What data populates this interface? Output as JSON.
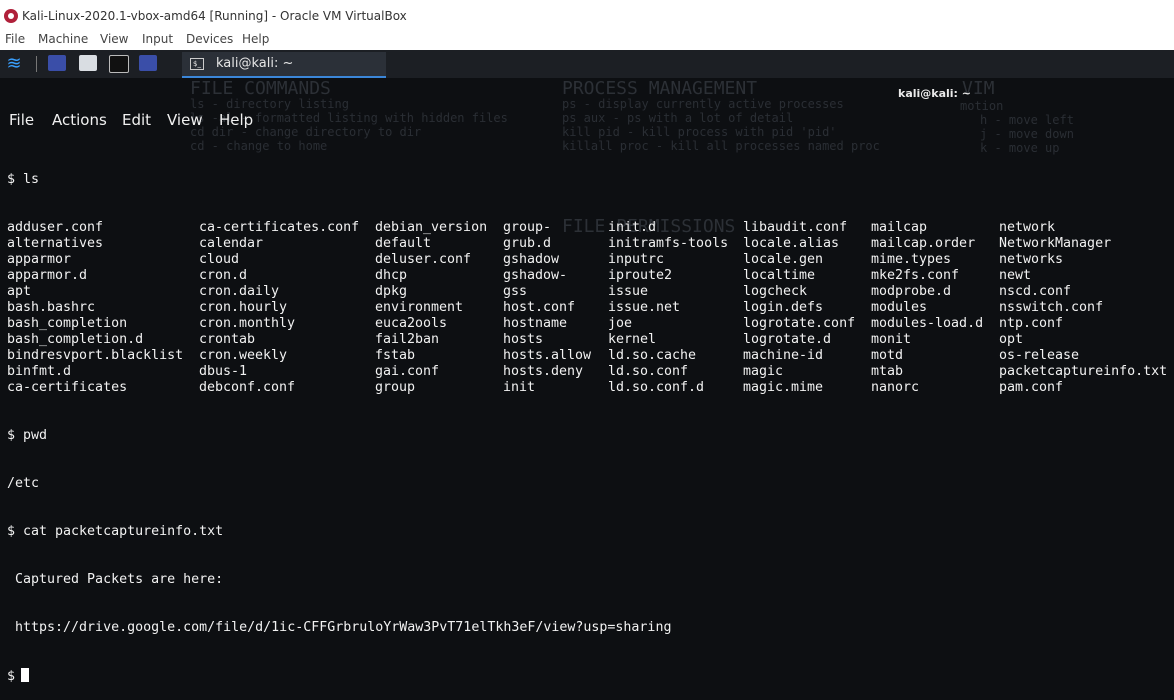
{
  "window": {
    "title": "Kali-Linux-2020.1-vbox-amd64 [Running] - Oracle VM VirtualBox"
  },
  "vbox_menu": [
    "File",
    "Machine",
    "View",
    "Input",
    "Devices",
    "Help"
  ],
  "taskbar": {
    "task_label": "kali@kali: ~"
  },
  "terminal": {
    "title": "kali@kali: ~",
    "menu": [
      "File",
      "Actions",
      "Edit",
      "View",
      "Help"
    ],
    "ls_prompt": "$ ls",
    "ls_rows": [
      [
        "adduser.conf",
        "ca-certificates.conf",
        "debian_version",
        "group-",
        "init.d",
        "libaudit.conf",
        "mailcap",
        "network"
      ],
      [
        "alternatives",
        "calendar",
        "default",
        "grub.d",
        "initramfs-tools",
        "locale.alias",
        "mailcap.order",
        "NetworkManager"
      ],
      [
        "apparmor",
        "cloud",
        "deluser.conf",
        "gshadow",
        "inputrc",
        "locale.gen",
        "mime.types",
        "networks"
      ],
      [
        "apparmor.d",
        "cron.d",
        "dhcp",
        "gshadow-",
        "iproute2",
        "localtime",
        "mke2fs.conf",
        "newt"
      ],
      [
        "apt",
        "cron.daily",
        "dpkg",
        "gss",
        "issue",
        "logcheck",
        "modprobe.d",
        "nscd.conf"
      ],
      [
        "bash.bashrc",
        "cron.hourly",
        "environment",
        "host.conf",
        "issue.net",
        "login.defs",
        "modules",
        "nsswitch.conf"
      ],
      [
        "bash_completion",
        "cron.monthly",
        "euca2ools",
        "hostname",
        "joe",
        "logrotate.conf",
        "modules-load.d",
        "ntp.conf"
      ],
      [
        "bash_completion.d",
        "crontab",
        "fail2ban",
        "hosts",
        "kernel",
        "logrotate.d",
        "monit",
        "opt"
      ],
      [
        "bindresvport.blacklist",
        "cron.weekly",
        "fstab",
        "hosts.allow",
        "ld.so.cache",
        "machine-id",
        "motd",
        "os-release"
      ],
      [
        "binfmt.d",
        "dbus-1",
        "gai.conf",
        "hosts.deny",
        "ld.so.conf",
        "magic",
        "mtab",
        "packetcaptureinfo.txt"
      ],
      [
        "ca-certificates",
        "debconf.conf",
        "group",
        "init",
        "ld.so.conf.d",
        "magic.mime",
        "nanorc",
        "pam.conf"
      ]
    ],
    "pwd_prompt": "$ pwd",
    "pwd_output": "/etc",
    "cat_prompt": "$ cat packetcaptureinfo.txt",
    "cat_line1": " Captured Packets are here:",
    "cat_line2": " https://drive.google.com/file/d/1ic-CFFGrbruloYrWaw3PvT71elTkh3eF/view?usp=sharing",
    "final_prompt": "$"
  },
  "wallpaper": {
    "h1": "FILE COMMANDS",
    "h2": "PROCESS MANAGEMENT",
    "h3": "VIM",
    "h4": "FILE PERMISSIONS",
    "l1": "ls - directory listing",
    "l2": "ls -al - formatted listing with hidden files",
    "l3": "cd dir - change directory to dir",
    "l4": "cd - change to home",
    "p1": "ps - display currently active processes",
    "p2": "ps aux - ps with a lot of detail",
    "p3": "kill pid - kill process with pid 'pid'",
    "p4": "killall proc - kill all processes named proc",
    "v1": "motion",
    "v2": "h - move left",
    "v3": "j - move down",
    "v4": "k - move up"
  },
  "colors": {
    "terminal_bg": "#0d0f12",
    "text": "#f2f2f2",
    "accent": "#3b86d8"
  }
}
